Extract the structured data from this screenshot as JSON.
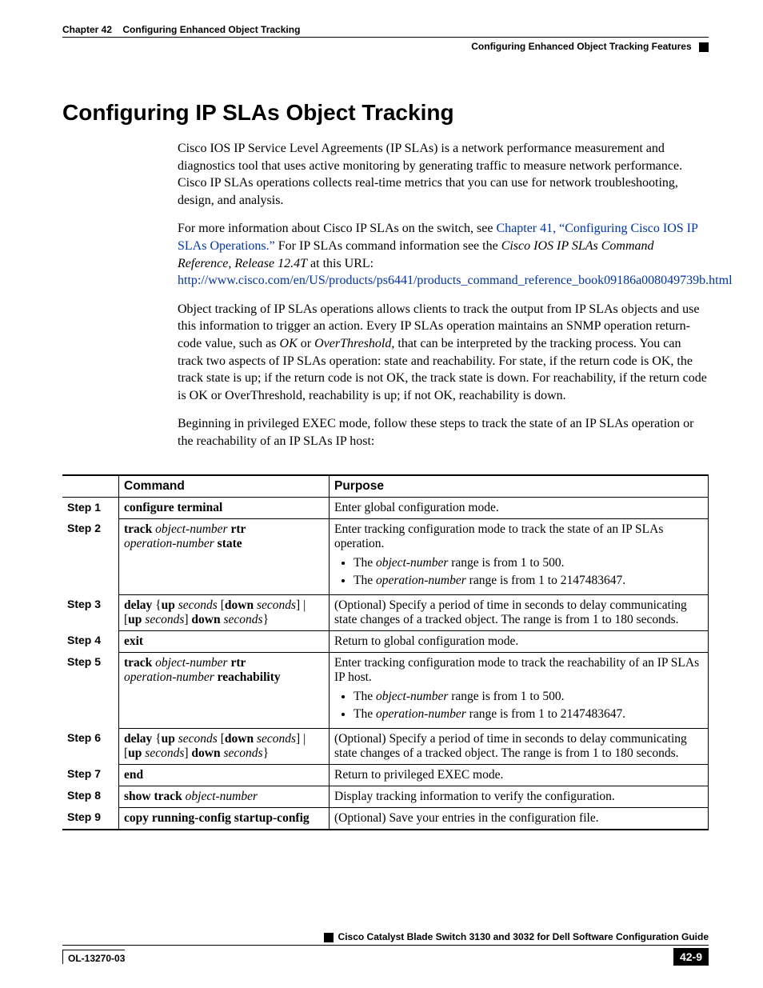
{
  "header": {
    "chapter": "Chapter 42",
    "chapter_title": "Configuring Enhanced Object Tracking",
    "section_right": "Configuring Enhanced Object Tracking Features"
  },
  "h2": "Configuring IP SLAs Object Tracking",
  "paras": {
    "p1": "Cisco IOS IP Service Level Agreements (IP SLAs) is a network performance measurement and diagnostics tool that uses active monitoring by generating traffic to measure network performance. Cisco IP SLAs operations collects real-time metrics that you can use for network troubleshooting, design, and analysis.",
    "p2_a": "For more information about Cisco IP SLAs on the switch, see ",
    "p2_link1": "Chapter 41, “Configuring Cisco IOS IP SLAs Operations.”",
    "p2_b": " For IP SLAs command information see the ",
    "p2_ital": "Cisco IOS IP SLAs Command Reference, Release 12.4T",
    "p2_c": " at this URL:",
    "p2_url": "http://www.cisco.com/en/US/products/ps6441/products_command_reference_book09186a008049739b.html",
    "p3_a": "Object tracking of IP SLAs operations allows clients to track the output from IP SLAs objects and use this information to trigger an action. Every IP SLAs operation maintains an SNMP operation return-code value, such as ",
    "p3_ok": "OK",
    "p3_b": " or ",
    "p3_ot": "OverThreshold",
    "p3_c": ", that can be interpreted by the tracking process. You can track two aspects of IP SLAs operation: state and reachability. For state, if the return code is OK, the track state is up; if the return code is not OK, the track state is down. For reachability, if the return code is OK or OverThreshold, reachability is up; if not OK, reachability is down.",
    "p4": "Beginning in privileged EXEC mode, follow these steps to track the state of an IP SLAs operation or the reachability of an IP SLAs IP host:"
  },
  "thead": {
    "blank": "",
    "command": "Command",
    "purpose": "Purpose"
  },
  "steps": [
    {
      "step": "Step 1",
      "cmd": [
        [
          {
            "t": "configure terminal",
            "b": true
          }
        ]
      ],
      "purp": {
        "text": "Enter global configuration mode."
      }
    },
    {
      "step": "Step 2",
      "cmd": [
        [
          {
            "t": "track ",
            "b": true
          },
          {
            "t": "object-number",
            "i": true
          },
          {
            "t": " rtr ",
            "b": true
          }
        ],
        [
          {
            "t": "operation-number",
            "i": true
          },
          {
            "t": " state",
            "b": true
          }
        ]
      ],
      "purp": {
        "text": "Enter tracking configuration mode to track the state of an IP SLAs operation.",
        "bullets": [
          [
            {
              "t": "The "
            },
            {
              "t": "object-number",
              "i": true
            },
            {
              "t": " range is from 1 to 500."
            }
          ],
          [
            {
              "t": "The "
            },
            {
              "t": "operation-number",
              "i": true
            },
            {
              "t": " range is from 1 to 2147483647."
            }
          ]
        ]
      }
    },
    {
      "step": "Step 3",
      "cmd": [
        [
          {
            "t": "delay ",
            "b": true
          },
          {
            "t": "{"
          },
          {
            "t": "up ",
            "b": true
          },
          {
            "t": "seconds",
            "i": true
          },
          {
            "t": " ["
          },
          {
            "t": "down ",
            "b": true
          },
          {
            "t": "seconds",
            "i": true
          },
          {
            "t": "] | "
          }
        ],
        [
          {
            "t": "["
          },
          {
            "t": "up ",
            "b": true
          },
          {
            "t": "seconds",
            "i": true
          },
          {
            "t": "] "
          },
          {
            "t": "down ",
            "b": true
          },
          {
            "t": "seconds",
            "i": true
          },
          {
            "t": "}"
          }
        ]
      ],
      "purp": {
        "text": "(Optional) Specify a period of time in seconds to delay communicating state changes of a tracked object. The range is from 1 to 180 seconds."
      }
    },
    {
      "step": "Step 4",
      "cmd": [
        [
          {
            "t": "exit",
            "b": true
          }
        ]
      ],
      "purp": {
        "text": "Return to global configuration mode."
      }
    },
    {
      "step": "Step 5",
      "cmd": [
        [
          {
            "t": "track ",
            "b": true
          },
          {
            "t": "object-number",
            "i": true
          },
          {
            "t": " rtr ",
            "b": true
          }
        ],
        [
          {
            "t": "operation-number",
            "i": true
          },
          {
            "t": " reachability",
            "b": true
          }
        ]
      ],
      "purp": {
        "text": "Enter tracking configuration mode to track the reachability of an IP SLAs IP host.",
        "bullets": [
          [
            {
              "t": "The "
            },
            {
              "t": "object-number",
              "i": true
            },
            {
              "t": " range is from 1 to 500."
            }
          ],
          [
            {
              "t": "The "
            },
            {
              "t": "operation-number",
              "i": true
            },
            {
              "t": " range is from 1 to 2147483647."
            }
          ]
        ]
      }
    },
    {
      "step": "Step 6",
      "cmd": [
        [
          {
            "t": "delay ",
            "b": true
          },
          {
            "t": "{"
          },
          {
            "t": "up ",
            "b": true
          },
          {
            "t": "seconds",
            "i": true
          },
          {
            "t": " ["
          },
          {
            "t": "down ",
            "b": true
          },
          {
            "t": "seconds",
            "i": true
          },
          {
            "t": "] | "
          }
        ],
        [
          {
            "t": "["
          },
          {
            "t": "up ",
            "b": true
          },
          {
            "t": "seconds",
            "i": true
          },
          {
            "t": "] "
          },
          {
            "t": "down ",
            "b": true
          },
          {
            "t": "seconds",
            "i": true
          },
          {
            "t": "}"
          }
        ]
      ],
      "purp": {
        "text": "(Optional) Specify a period of time in seconds to delay communicating state changes of a tracked object. The range is from 1 to 180 seconds."
      }
    },
    {
      "step": "Step 7",
      "cmd": [
        [
          {
            "t": "end",
            "b": true
          }
        ]
      ],
      "purp": {
        "text": "Return to privileged EXEC mode."
      }
    },
    {
      "step": "Step 8",
      "cmd": [
        [
          {
            "t": "show track ",
            "b": true
          },
          {
            "t": "object-number",
            "i": true
          }
        ]
      ],
      "purp": {
        "text": "Display tracking information to verify the configuration."
      }
    },
    {
      "step": "Step 9",
      "cmd": [
        [
          {
            "t": "copy running-config startup-config",
            "b": true
          }
        ]
      ],
      "purp": {
        "text": "(Optional) Save your entries in the configuration file."
      }
    }
  ],
  "footer": {
    "title": "Cisco Catalyst Blade Switch 3130 and 3032 for Dell Software Configuration Guide",
    "doc": "OL-13270-03",
    "page": "42-9"
  }
}
